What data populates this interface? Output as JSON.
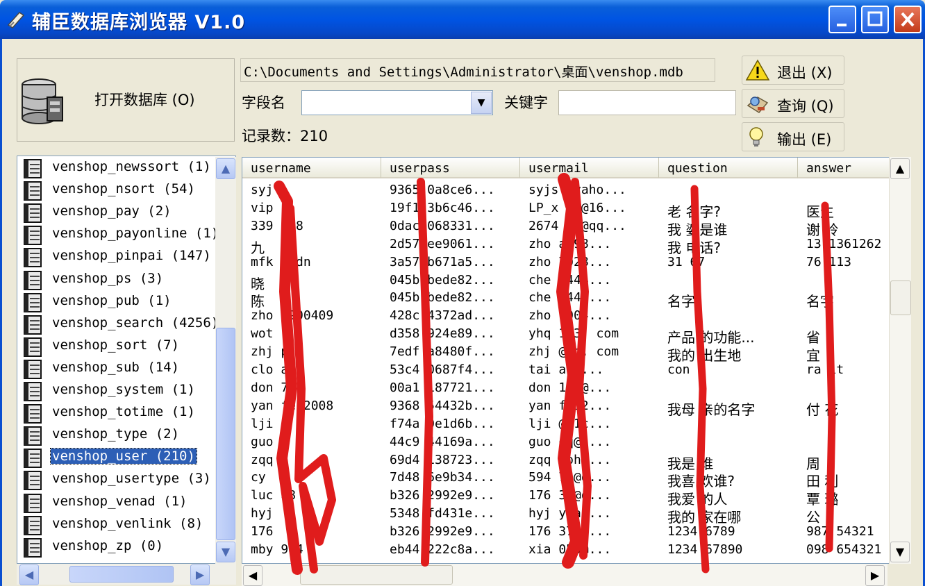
{
  "window": {
    "title": "辅臣数据库浏览器 V1.0"
  },
  "open_db": {
    "label": "打开数据库 (O)"
  },
  "path": "C:\\Documents and Settings\\Administrator\\桌面\\venshop.mdb",
  "field_label": "字段名",
  "keyword_label": "关键字",
  "record_count": "记录数：210",
  "buttons": {
    "exit": "退出 (X)",
    "query": "查询 (Q)",
    "export": "输出 (E)"
  },
  "tables": [
    "venshop_newssort (1)",
    "venshop_nsort (54)",
    "venshop_pay (2)",
    "venshop_payonline (1)",
    "venshop_pinpai (147)",
    "venshop_ps (3)",
    "venshop_pub (1)",
    "venshop_search (4256)",
    "venshop_sort (7)",
    "venshop_sub (14)",
    "venshop_system (1)",
    "venshop_totime (1)",
    "venshop_type (2)",
    "venshop_user (210)",
    "venshop_usertype (3)",
    "venshop_venad (1)",
    "venshop_venlink (8)",
    "venshop_zp (0)"
  ],
  "selected_table": "venshop_user (210)",
  "columns": [
    "username",
    "userpass",
    "usermail",
    "question",
    "answer"
  ],
  "rows": [
    [
      "syj",
      "9365 0a8ce6...",
      "syjs @yaho...",
      "",
      ""
    ],
    [
      "vip c",
      "19f1 3b6c46...",
      "LP_x ip@16...",
      "老 名字?",
      "医生"
    ],
    [
      "339 098",
      "0dac 068331...",
      "2674 91@qq...",
      "我 婆是谁",
      "谢 玲"
    ],
    [
      "九",
      "2d57 ee9061...",
      "zho a198...",
      "我 电话?",
      "13 1361262"
    ],
    [
      "mfk dhdn",
      "3a57 b671a5...",
      "zho 7028...",
      "31 67",
      "76 113"
    ],
    [
      "晓",
      "045b bede82...",
      "che e444...",
      "",
      ""
    ],
    [
      "陈",
      "045b bede82...",
      "che e444...",
      "名字",
      "名字"
    ],
    [
      "zho n900409",
      "428c 4372ad...",
      "zho 9004...",
      "",
      ""
    ],
    [
      "wot",
      "d358 924e89...",
      "yhq 163. com",
      "产品 的功能...",
      "省"
    ],
    [
      "zhj p",
      "7edf a8480f...",
      "zhj @qq. com",
      "我的 出生地",
      "宜"
    ],
    [
      "clo an",
      "53c4 0687f4...",
      "tai an@...",
      "con u",
      "ra it"
    ],
    [
      "don 7",
      "00a1 187721...",
      "don 127@...",
      "",
      ""
    ],
    [
      "yan fei2008",
      "9368 54432b...",
      "yan fei2...",
      "我母 亲的名字",
      "付 花"
    ],
    [
      "lji 5",
      "f74a 0e1d6b...",
      "lji @21c...",
      "",
      ""
    ],
    [
      "guo e",
      "44c9 44169a...",
      "guo qq@1...",
      "",
      ""
    ],
    [
      "zqq 7",
      "69d4 138723...",
      "zqq sohu...",
      "我是 谁",
      "周"
    ],
    [
      "cy",
      "7d48 6e9b34...",
      "594 78@q...",
      "我喜 欢谁?",
      "田 利"
    ],
    [
      "luc 88",
      "b326 2992e9...",
      "176 37@q...",
      "我爱 的人",
      "覃 璐"
    ],
    [
      "hyj",
      "5348 fd431e...",
      "hyj yeah...",
      "我的 家在哪",
      "公"
    ],
    [
      "176",
      "b326 2992e9...",
      "176 37@q...",
      "1234 6789",
      "987 54321"
    ],
    [
      "mby 984",
      "eb44 222c8a...",
      "xia 050@...",
      "1234 67890",
      "098 654321"
    ]
  ]
}
